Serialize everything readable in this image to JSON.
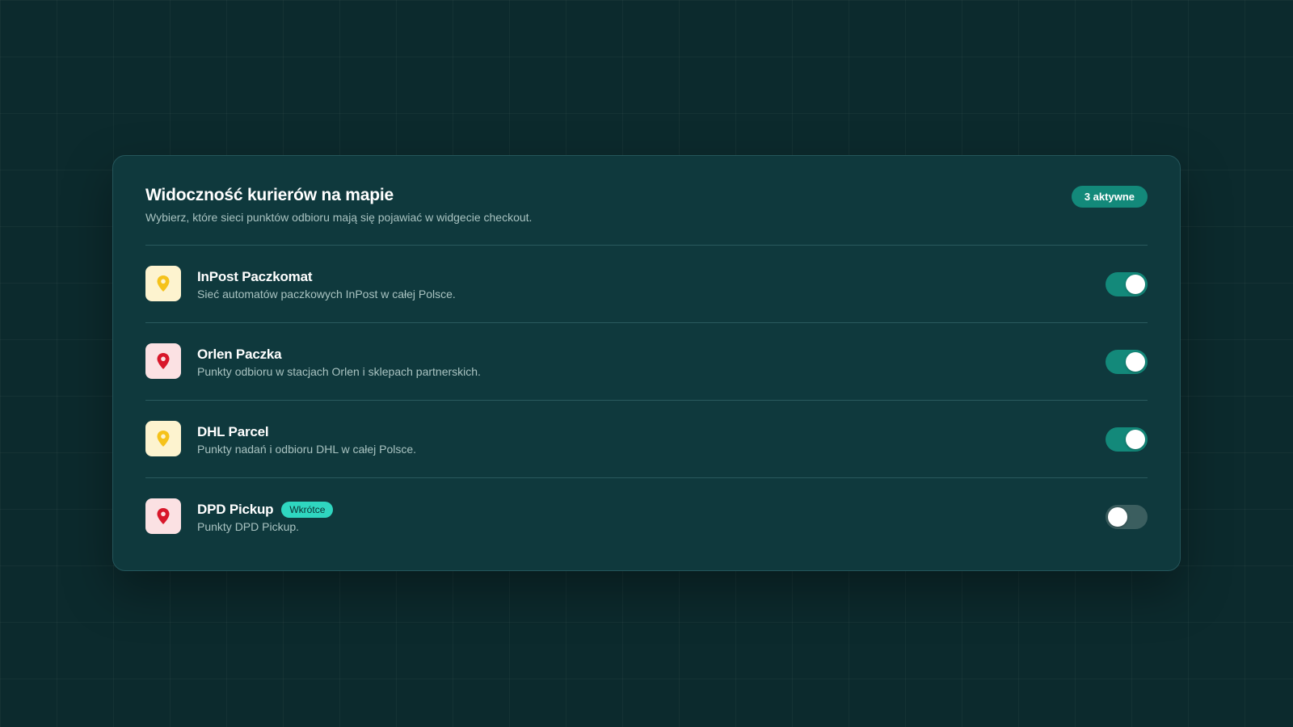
{
  "panel": {
    "title": "Widoczność kurierów na mapie",
    "subtitle": "Wybierz, które sieci punktów odbioru mają się pojawiać w widgecie checkout.",
    "active_badge": "3 aktywne"
  },
  "couriers": [
    {
      "name": "InPost Paczkomat",
      "description": "Sieć automatów paczkowych InPost w całej Polsce.",
      "enabled": true,
      "icon": "map-pin-icon",
      "icon_bg": "#fdf3cf",
      "icon_color": "#f5c21b"
    },
    {
      "name": "Orlen Paczka",
      "description": "Punkty odbioru w stacjach Orlen i sklepach partnerskich.",
      "enabled": true,
      "icon": "map-pin-icon",
      "icon_bg": "#fbe1e3",
      "icon_color": "#d8172a"
    },
    {
      "name": "DHL Parcel",
      "description": "Punkty nadań i odbioru DHL w całej Polsce.",
      "enabled": true,
      "icon": "map-pin-icon",
      "icon_bg": "#fdf3cf",
      "icon_color": "#f5c21b"
    },
    {
      "name": "DPD Pickup",
      "description": "Punkty DPD Pickup.",
      "enabled": false,
      "badge": "Wkrótce",
      "icon": "map-pin-icon",
      "icon_bg": "#fbe1e3",
      "icon_color": "#d8172a"
    }
  ],
  "colors": {
    "accent": "#13897a",
    "toggle_off": "#3b5e5f",
    "soon_badge": "#2fd6c0"
  }
}
